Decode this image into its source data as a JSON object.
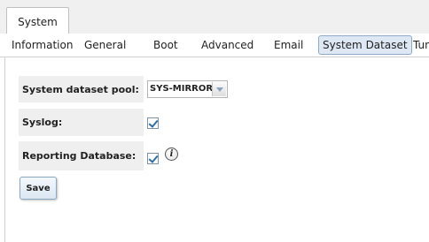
{
  "window_tab": {
    "label": "System"
  },
  "subtabs": [
    {
      "label": "Information"
    },
    {
      "label": "General"
    },
    {
      "label": "Boot"
    },
    {
      "label": "Advanced"
    },
    {
      "label": "Email"
    },
    {
      "label": "System Dataset",
      "active": true
    },
    {
      "label": "Tun"
    }
  ],
  "form": {
    "pool_label": "System dataset pool:",
    "pool_value": "SYS-MIRROR",
    "syslog_label": "Syslog:",
    "syslog_checked": true,
    "reporting_label": "Reporting Database:",
    "reporting_checked": true,
    "info_glyph": "i",
    "save_label": "Save"
  },
  "colors": {
    "active_tab_bg": "#dde8f4",
    "active_tab_border": "#8fa9c6",
    "row_bg": "#efefef",
    "checkbox_check": "#2f6fa8"
  }
}
